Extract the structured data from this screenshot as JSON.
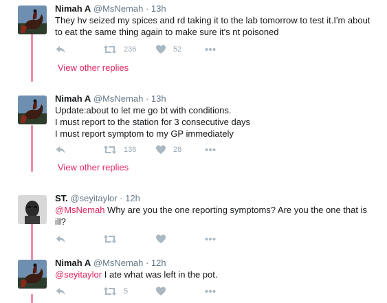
{
  "tweets": [
    {
      "name": "Nimah A",
      "handle": "@MsNemah",
      "time": "13h",
      "lines": [
        "They hv seized my spices and rd taking it to the lab tomorrow to test it.I'm about",
        "to eat the same thing again to make sure it's nt poisoned"
      ],
      "retweets": "236",
      "likes": "52",
      "view_more": "View other replies"
    },
    {
      "name": "Nimah A",
      "handle": "@MsNemah",
      "time": "13h",
      "lines": [
        "Update:about to let me go bt with conditions.",
        "I must report to the station for 3 consecutive days",
        "I must report symptom to my GP immediately"
      ],
      "retweets": "136",
      "likes": "28",
      "view_more": "View other replies"
    },
    {
      "name": "ST.",
      "handle": "@seyitaylor",
      "time": "12h",
      "mention": "@MsNemah",
      "text_line1": " Why are you the one reporting symptoms? Are you the one that is",
      "text_line2": "ill?",
      "retweets": "",
      "likes": ""
    },
    {
      "name": "Nimah A",
      "handle": "@MsNemah",
      "time": "12h",
      "mention": "@seyitaylor",
      "text": " I ate what was left in the pot.",
      "retweets": "5",
      "likes": ""
    }
  ],
  "separator": "·",
  "icons": {
    "reply": "reply-icon",
    "retweet": "retweet-icon",
    "like": "heart-icon",
    "more": "more-dots-icon"
  },
  "colors": {
    "thread_line": "#f08da7",
    "link": "#e0245e",
    "muted": "#657786",
    "icon": "#aab8c2"
  }
}
